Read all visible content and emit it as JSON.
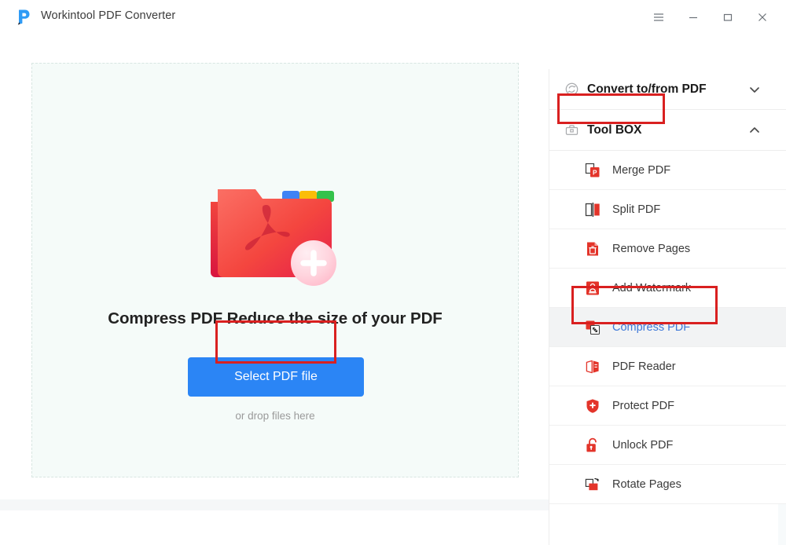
{
  "window": {
    "title": "Workintool PDF Converter",
    "logo_icon": "workintool-p-logo",
    "controls": [
      {
        "name": "menu-button",
        "icon": "hamburger-icon"
      },
      {
        "name": "minimize-button",
        "icon": "minimize-icon"
      },
      {
        "name": "maximize-button",
        "icon": "maximize-icon"
      },
      {
        "name": "close-button",
        "icon": "close-icon"
      }
    ]
  },
  "main": {
    "illustration_icon": "pdf-folder-add-icon",
    "headline": "Compress PDF Reduce the size of your PDF",
    "select_button_label": "Select PDF file",
    "drop_hint": "or drop files here"
  },
  "sidebar": {
    "groups": [
      {
        "label": "Convert to/from PDF",
        "icon": "convert-circle-icon",
        "chevron": "chevron-down-icon",
        "expanded": false
      },
      {
        "label": "Tool BOX",
        "icon": "toolbox-icon",
        "chevron": "chevron-up-icon",
        "expanded": true,
        "highlighted": true
      }
    ],
    "items": [
      {
        "label": "Merge PDF",
        "icon": "merge-pdf-icon",
        "selected": false
      },
      {
        "label": "Split PDF",
        "icon": "split-pdf-icon",
        "selected": false
      },
      {
        "label": "Remove Pages",
        "icon": "remove-pages-icon",
        "selected": false
      },
      {
        "label": "Add Watermark",
        "icon": "add-watermark-icon",
        "selected": false
      },
      {
        "label": "Compress PDF",
        "icon": "compress-pdf-icon",
        "selected": true
      },
      {
        "label": "PDF Reader",
        "icon": "pdf-reader-icon",
        "selected": false
      },
      {
        "label": "Protect PDF",
        "icon": "protect-pdf-icon",
        "selected": false
      },
      {
        "label": "Unlock PDF",
        "icon": "unlock-pdf-icon",
        "selected": false
      },
      {
        "label": "Rotate Pages",
        "icon": "rotate-pages-icon",
        "selected": false
      }
    ]
  },
  "annotations": [
    {
      "name": "annotation-toolbox",
      "target": "Tool BOX"
    },
    {
      "name": "annotation-compress",
      "target": "Compress PDF"
    },
    {
      "name": "annotation-select",
      "target": "Select PDF file"
    }
  ],
  "colors": {
    "accent_blue": "#2b85f5",
    "selected_text_blue": "#3e78d8",
    "icon_red": "#e3342a",
    "annotation_red": "#d92020",
    "dropzone_bg": "#f5fbf9",
    "selected_row_bg": "#f2f3f4"
  }
}
